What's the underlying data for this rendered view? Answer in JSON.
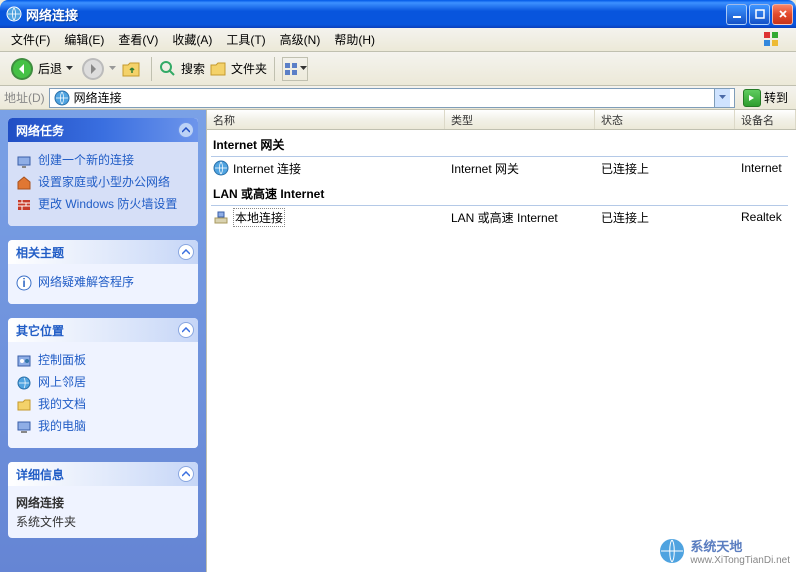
{
  "window": {
    "title": "网络连接"
  },
  "menu": [
    "文件(F)",
    "编辑(E)",
    "查看(V)",
    "收藏(A)",
    "工具(T)",
    "高级(N)",
    "帮助(H)"
  ],
  "toolbar": {
    "back": "后退",
    "search": "搜索",
    "folders": "文件夹"
  },
  "addressbar": {
    "label": "地址(D)",
    "value": "网络连接",
    "go": "转到"
  },
  "sidebar": {
    "network_tasks": {
      "title": "网络任务",
      "items": [
        "创建一个新的连接",
        "设置家庭或小型办公网络",
        "更改 Windows 防火墙设置"
      ]
    },
    "see_also": {
      "title": "相关主题",
      "items": [
        "网络疑难解答程序"
      ]
    },
    "other_places": {
      "title": "其它位置",
      "items": [
        "控制面板",
        "网上邻居",
        "我的文档",
        "我的电脑"
      ]
    },
    "details": {
      "title": "详细信息",
      "header": "网络连接",
      "sub": "系统文件夹"
    }
  },
  "columns": [
    "名称",
    "类型",
    "状态",
    "设备名"
  ],
  "groups": [
    {
      "header": "Internet 网关",
      "items": [
        {
          "name": "Internet 连接",
          "type": "Internet 网关",
          "status": "已连接上",
          "device": "Internet",
          "selected": false
        }
      ]
    },
    {
      "header": "LAN 或高速 Internet",
      "items": [
        {
          "name": "本地连接",
          "type": "LAN 或高速 Internet",
          "status": "已连接上",
          "device": "Realtek",
          "selected": true
        }
      ]
    }
  ],
  "watermark": {
    "text": "系统天地",
    "url": "www.XiTongTianDi.net"
  }
}
